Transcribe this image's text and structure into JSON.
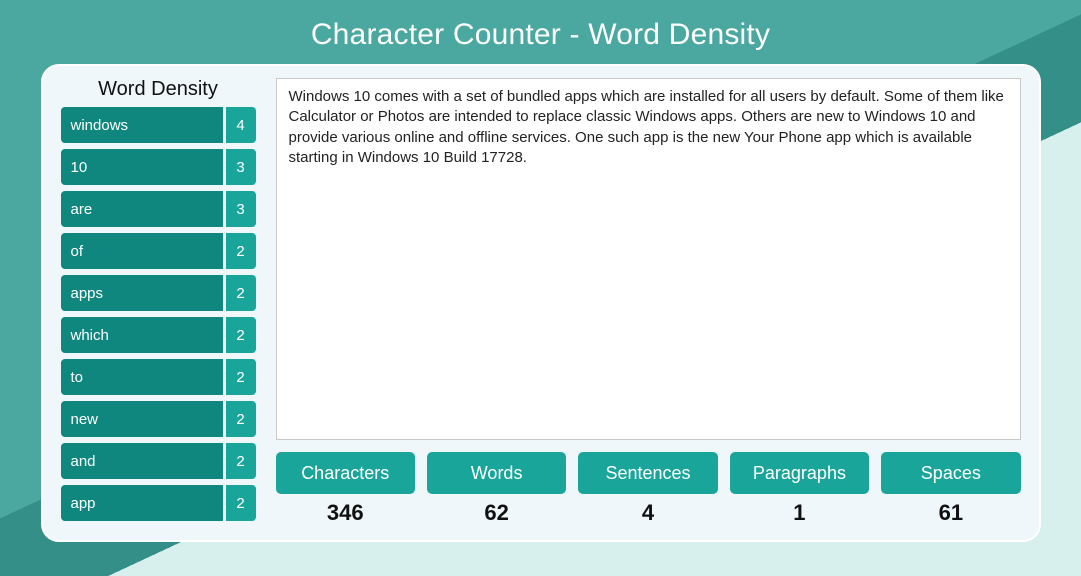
{
  "header": {
    "title": "Character Counter - Word Density"
  },
  "sidebar": {
    "title": "Word Density",
    "items": [
      {
        "word": "windows",
        "count": 4
      },
      {
        "word": "10",
        "count": 3
      },
      {
        "word": "are",
        "count": 3
      },
      {
        "word": "of",
        "count": 2
      },
      {
        "word": "apps",
        "count": 2
      },
      {
        "word": "which",
        "count": 2
      },
      {
        "word": "to",
        "count": 2
      },
      {
        "word": "new",
        "count": 2
      },
      {
        "word": "and",
        "count": 2
      },
      {
        "word": "app",
        "count": 2
      }
    ]
  },
  "main": {
    "text": "Windows 10 comes with a set of bundled apps which are installed for all users by default. Some of them like Calculator or Photos are intended to replace classic Windows apps. Others are new to Windows 10 and provide various online and offline services. One such app is the new Your Phone app which is available starting in Windows 10 Build 17728."
  },
  "stats": {
    "characters": {
      "label": "Characters",
      "value": 346
    },
    "words": {
      "label": "Words",
      "value": 62
    },
    "sentences": {
      "label": "Sentences",
      "value": 4
    },
    "paragraphs": {
      "label": "Paragraphs",
      "value": 1
    },
    "spaces": {
      "label": "Spaces",
      "value": 61
    }
  }
}
